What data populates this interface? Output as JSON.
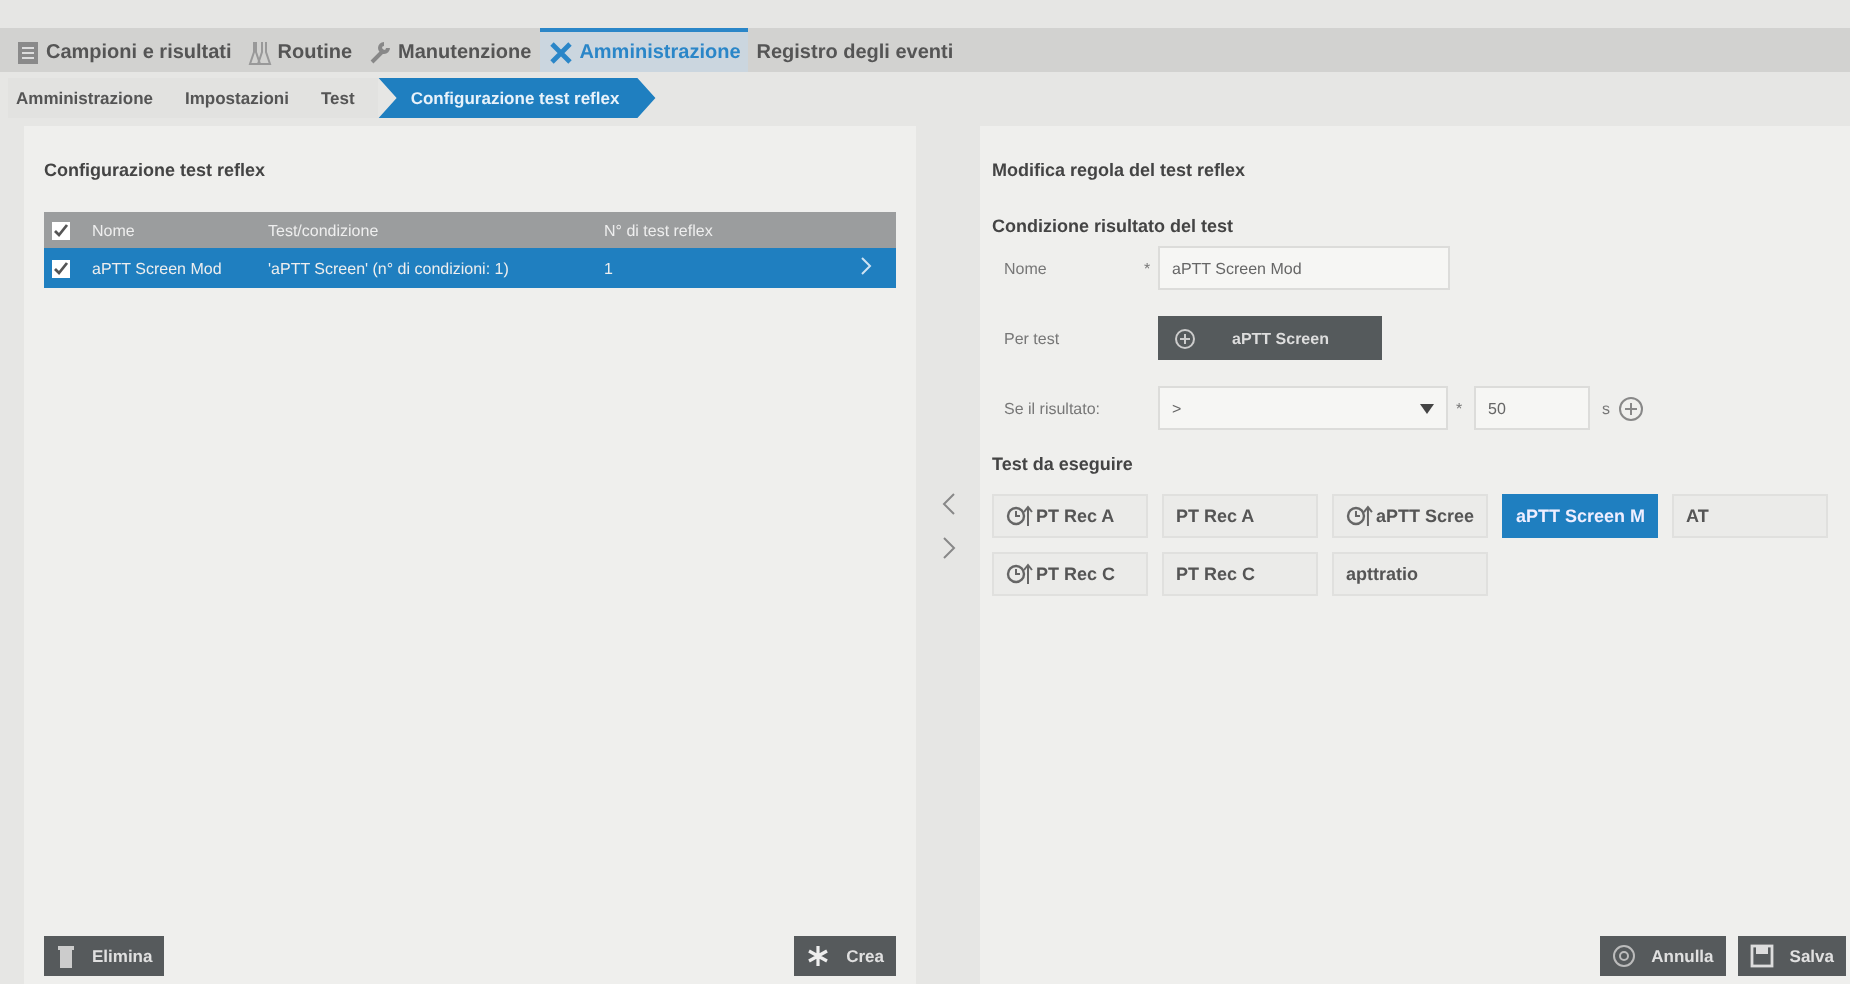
{
  "menu": [
    {
      "label": "Campioni e risultati",
      "selected": false
    },
    {
      "label": "Routine",
      "selected": false
    },
    {
      "label": "Manutenzione",
      "selected": false
    },
    {
      "label": "Amministrazione",
      "selected": true
    },
    {
      "label": "Registro degli eventi",
      "selected": false
    }
  ],
  "breadcrumb": [
    {
      "label": "Amministrazione",
      "selected": false
    },
    {
      "label": "Impostazioni",
      "selected": false
    },
    {
      "label": "Test",
      "selected": false
    },
    {
      "label": "Configurazione test reflex",
      "selected": true
    }
  ],
  "left_panel": {
    "title": "Configurazione test reflex",
    "table": {
      "all_checked": true,
      "columns": [
        "Nome",
        "Test/condizione",
        "N° di test reflex"
      ],
      "rows": [
        {
          "cells": [
            "aPTT Screen Mod",
            "'aPTT Screen' (n° di condizioni: 1)",
            "1"
          ],
          "checked": true,
          "selected": true
        }
      ]
    },
    "buttons": [
      "Elimina",
      "Crea"
    ]
  },
  "right_panel": {
    "title": "Modifica regola del test reflex",
    "section": "Condizione risultato del test",
    "name_field": {
      "label": "Nome",
      "required_mark": "*",
      "value": "aPTT Screen Mod"
    },
    "per_test": {
      "label": "Per test",
      "value": "aPTT Screen"
    },
    "result": {
      "label": "Se il risultato:",
      "operator": ">",
      "required_mark": "*",
      "value": "50",
      "unit": "s"
    },
    "tests_title": "Test da eseguire",
    "tests": [
      {
        "label": "PT Rec A",
        "timed": true,
        "selected": false
      },
      {
        "label": "PT Rec A",
        "timed": false,
        "selected": false
      },
      {
        "label": "aPTT Scree",
        "timed": true,
        "selected": false
      },
      {
        "label": "aPTT Screen M",
        "timed": false,
        "selected": true
      },
      {
        "label": "AT",
        "timed": false,
        "selected": false
      },
      {
        "label": "PT Rec C",
        "timed": true,
        "selected": false
      },
      {
        "label": "PT Rec C",
        "timed": false,
        "selected": false
      },
      {
        "label": "apttratio",
        "timed": false,
        "selected": false
      }
    ],
    "buttons": [
      "Annulla",
      "Salva"
    ]
  }
}
